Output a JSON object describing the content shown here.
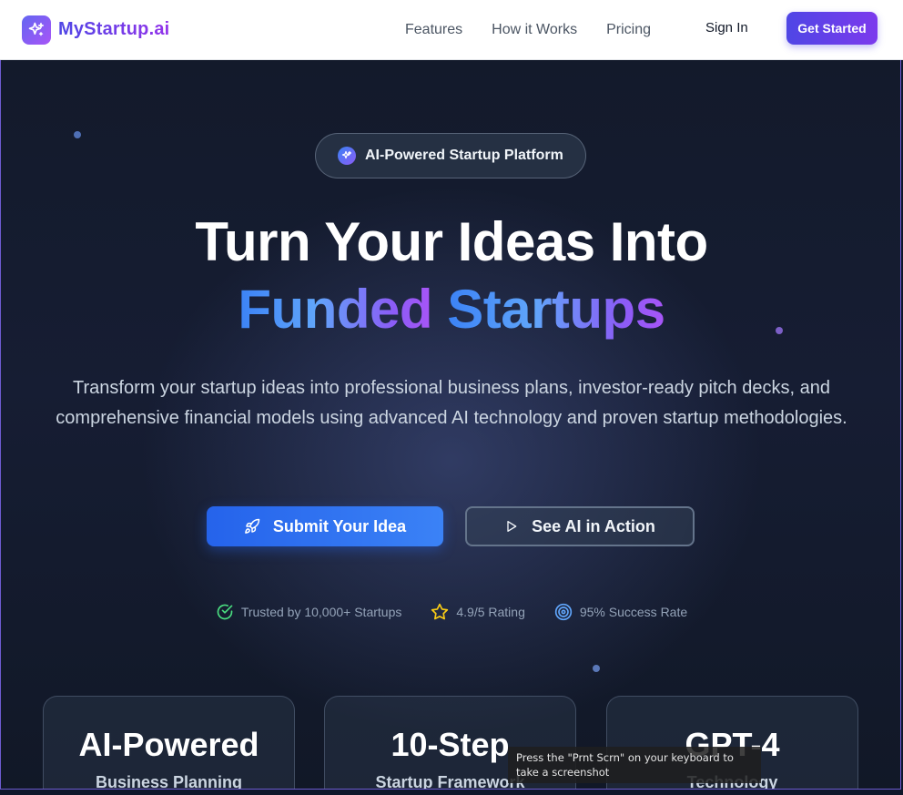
{
  "navbar": {
    "brand": "MyStartup.ai",
    "links": [
      "Features",
      "How it Works",
      "Pricing"
    ],
    "signin": "Sign In",
    "cta": "Get Started"
  },
  "hero": {
    "badge": "AI-Powered Startup Platform",
    "headline_line1": "Turn Your Ideas Into",
    "headline_word1": "Funded",
    "headline_word2": "Startups",
    "subtitle": "Transform your startup ideas into professional business plans, investor-ready pitch decks, and comprehensive financial models using advanced AI technology and proven startup methodologies.",
    "primary_button": "Submit Your Idea",
    "secondary_button": "See AI in Action",
    "stats": [
      {
        "icon": "check-circle-icon",
        "label": "Trusted by 10,000+ Startups"
      },
      {
        "icon": "star-icon",
        "label": "4.9/5 Rating"
      },
      {
        "icon": "target-icon",
        "label": "95% Success Rate"
      }
    ]
  },
  "cards": [
    {
      "title": "AI-Powered",
      "subtitle": "Business Planning"
    },
    {
      "title": "10-Step",
      "subtitle": "Startup Framework"
    },
    {
      "title": "GPT-4",
      "subtitle": "Technology"
    }
  ],
  "tooltip": "Press the \"Prnt Scrn\" on your keyboard to take a screenshot",
  "colors": {
    "brand_gradient_start": "#4f46e5",
    "brand_gradient_end": "#9333ea",
    "primary_blue": "#2563eb",
    "hero_bg": "#161d33"
  }
}
